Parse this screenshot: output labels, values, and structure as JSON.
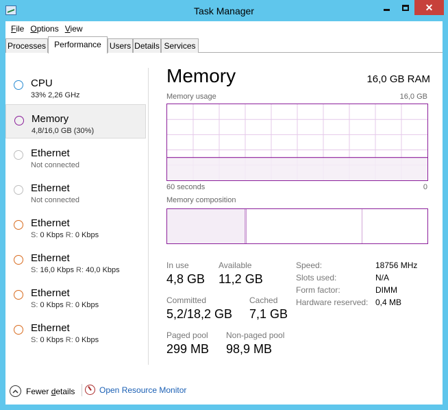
{
  "window": {
    "title": "Task Manager",
    "icons": {
      "app": "task-manager-icon",
      "minimize": "minimize-icon",
      "maximize": "maximize-icon",
      "close": "close-icon"
    },
    "close_glyph": "✕"
  },
  "menu": {
    "file": "File",
    "options": "Options",
    "view": "View"
  },
  "tabs": [
    "Processes",
    "Performance",
    "Users",
    "Details",
    "Services"
  ],
  "active_tab": "Performance",
  "sidebar": [
    {
      "title": "CPU",
      "sub": "33% 2,26 GHz",
      "circle_color": "#2a8bd2",
      "selected": false
    },
    {
      "title": "Memory",
      "sub": "4,8/16,0 GB (30%)",
      "circle_color": "#8b1e9a",
      "selected": true
    },
    {
      "title": "Ethernet",
      "sub": "Not connected",
      "circle_color": "#bdbdbd",
      "selected": false
    },
    {
      "title": "Ethernet",
      "sub": "Not connected",
      "circle_color": "#bdbdbd",
      "selected": false
    },
    {
      "title": "Ethernet",
      "s_label": "S:",
      "s_value": "0 Kbps",
      "r_label": "R:",
      "r_value": "0 Kbps",
      "circle_color": "#d86b1e",
      "selected": false
    },
    {
      "title": "Ethernet",
      "s_label": "S:",
      "s_value": "16,0 Kbps",
      "r_label": "R:",
      "r_value": "40,0 Kbps",
      "circle_color": "#d86b1e",
      "selected": false
    },
    {
      "title": "Ethernet",
      "s_label": "S:",
      "s_value": "0 Kbps",
      "r_label": "R:",
      "r_value": "0 Kbps",
      "circle_color": "#d86b1e",
      "selected": false
    },
    {
      "title": "Ethernet",
      "s_label": "S:",
      "s_value": "0 Kbps",
      "r_label": "R:",
      "r_value": "0 Kbps",
      "circle_color": "#d86b1e",
      "selected": false
    }
  ],
  "memory": {
    "title": "Memory",
    "total": "16,0 GB RAM",
    "usage_chart": {
      "label": "Memory usage",
      "max_label": "16,0 GB",
      "time_label": "60 seconds",
      "zero_label": "0",
      "used_fraction": 0.3,
      "accent_color": "#8b1e9a",
      "fill_color": "#f4edf6"
    },
    "composition": {
      "label": "Memory composition",
      "in_use_fraction": 0.3,
      "modified_fraction": 0.005,
      "standby_fraction": 0.444,
      "free_fraction": 0.251
    },
    "stats": {
      "in_use": {
        "label": "In use",
        "value": "4,8 GB"
      },
      "available": {
        "label": "Available",
        "value": "11,2 GB"
      },
      "committed": {
        "label": "Committed",
        "value": "5,2/18,2 GB"
      },
      "cached": {
        "label": "Cached",
        "value": "7,1 GB"
      },
      "paged_pool": {
        "label": "Paged pool",
        "value": "299 MB"
      },
      "non_paged_pool": {
        "label": "Non-paged pool",
        "value": "98,9 MB"
      }
    },
    "specs": {
      "speed": {
        "label": "Speed:",
        "value": "18756 MHz"
      },
      "slots": {
        "label": "Slots used:",
        "value": "N/A"
      },
      "form": {
        "label": "Form factor:",
        "value": "DIMM"
      },
      "hw_reserved": {
        "label": "Hardware reserved:",
        "value": "0,4 MB"
      }
    }
  },
  "footer": {
    "fewer_details": "Fewer details",
    "open_resource_monitor": "Open Resource Monitor"
  }
}
